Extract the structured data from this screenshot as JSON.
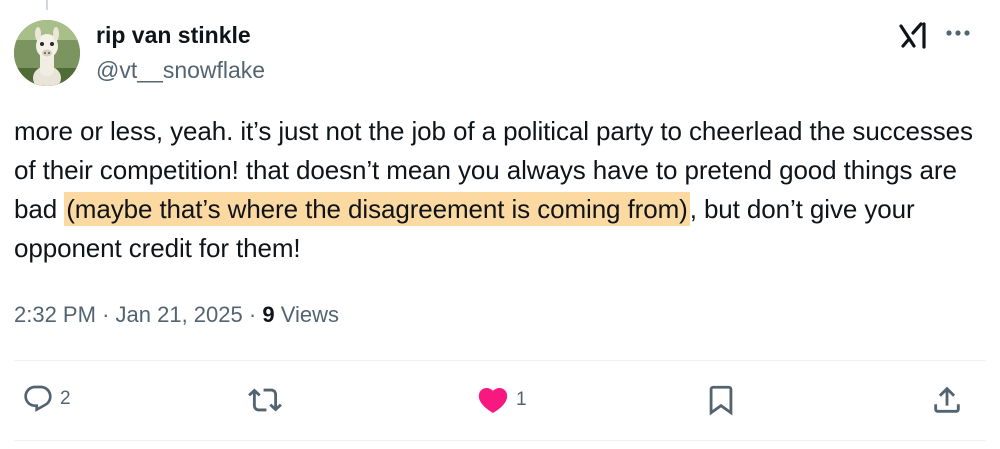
{
  "author": {
    "display_name": "rip van stinkle",
    "handle": "@vt__snowflake"
  },
  "tweet": {
    "text_before": "more or less, yeah. it’s just not the job of a political party to cheerlead the successes of their competition! that doesn’t mean you always have to pretend good things are bad ",
    "text_highlight": "(maybe that’s where the disagreement is coming from)",
    "text_after": ", but don’t give your opponent credit for them!",
    "highlight_color": "#fdd9a2"
  },
  "meta": {
    "time": "2:32 PM",
    "date": "Jan 21, 2025",
    "separator": "·",
    "views_count": "9",
    "views_label": "Views"
  },
  "actions": {
    "reply": {
      "icon": "reply-icon",
      "count": "2"
    },
    "retweet": {
      "icon": "retweet-icon",
      "count": ""
    },
    "like": {
      "icon": "heart-icon",
      "count": "1",
      "color": "#f91880"
    },
    "bookmark": {
      "icon": "bookmark-icon",
      "count": ""
    },
    "share": {
      "icon": "share-icon",
      "count": ""
    }
  },
  "header_icons": {
    "logo": "grok-logo-icon",
    "more": "more-options-icon"
  }
}
